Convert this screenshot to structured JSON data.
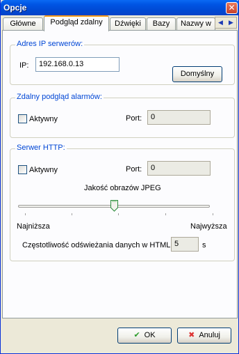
{
  "window": {
    "title": "Opcje",
    "close_glyph": "✕"
  },
  "tabs": [
    {
      "label": "Główne"
    },
    {
      "label": "Podgląd zdalny"
    },
    {
      "label": "Dźwięki"
    },
    {
      "label": "Bazy"
    },
    {
      "label": "Nazwy w"
    }
  ],
  "tab_scroll": {
    "left_glyph": "◀",
    "right_glyph": "▶"
  },
  "server_ip": {
    "title": "Adres IP serwerów:",
    "ip_label": "IP:",
    "ip_value": "192.168.0.13",
    "default_button": "Domyślny"
  },
  "alarms": {
    "title": "Zdalny podgląd alarmów:",
    "active_label": "Aktywny",
    "port_label": "Port:",
    "port_value": "0"
  },
  "http": {
    "title": "Serwer HTTP:",
    "active_label": "Aktywny",
    "port_label": "Port:",
    "port_value": "0",
    "jpeg_label": "Jakość obrazów JPEG",
    "jpeg_level": 0.5,
    "min_label": "Najniższa",
    "max_label": "Najwyższa",
    "refresh_label": "Częstotliwość odświeżania danych w HTML:",
    "refresh_value": "5",
    "refresh_unit": "s"
  },
  "footer": {
    "ok_label": "OK",
    "cancel_label": "Anuluj"
  },
  "colors": {
    "accent": "#0046d5",
    "title_bar": "#0054e3"
  }
}
